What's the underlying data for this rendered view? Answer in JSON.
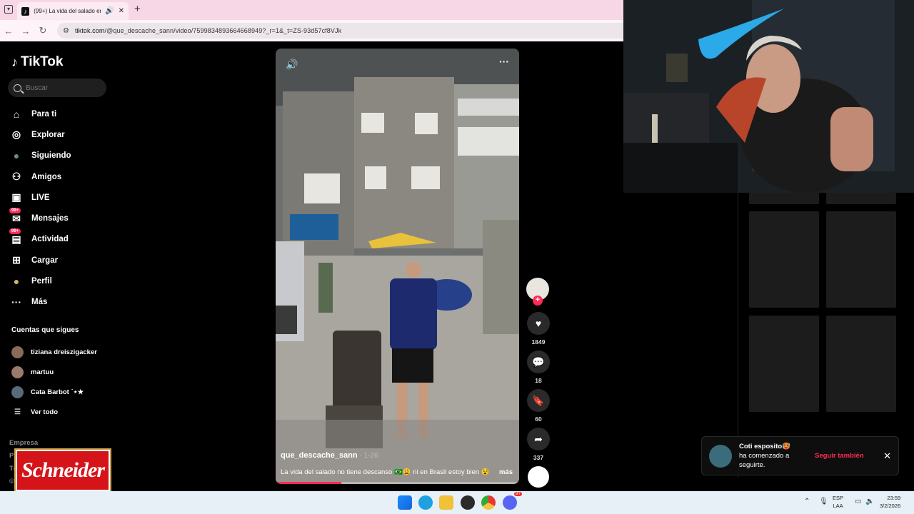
{
  "browser": {
    "tab_title": "(99+) La vida del salado en",
    "tab_sound_icon": "speaker-icon",
    "tab_close": "✕",
    "new_tab": "+",
    "url_domain": "tiktok.com",
    "url_path": "/@que_descache_sann/video/7599834893664668949?_r=1&_t=ZS-93d57cf8VJk"
  },
  "sidebar": {
    "brand": "TikTok",
    "search_placeholder": "Buscar",
    "nav": [
      {
        "label": "Para ti",
        "icon": "home-icon"
      },
      {
        "label": "Explorar",
        "icon": "compass-icon"
      },
      {
        "label": "Siguiendo",
        "icon": "following-avatar-icon"
      },
      {
        "label": "Amigos",
        "icon": "friends-icon"
      },
      {
        "label": "LIVE",
        "icon": "live-icon"
      },
      {
        "label": "Mensajes",
        "icon": "messages-icon",
        "badge": "99+"
      },
      {
        "label": "Actividad",
        "icon": "activity-icon",
        "badge": "99+"
      },
      {
        "label": "Cargar",
        "icon": "upload-icon"
      },
      {
        "label": "Perfil",
        "icon": "profile-avatar-icon"
      },
      {
        "label": "Más",
        "icon": "more-dots-icon"
      }
    ],
    "following_header": "Cuentas que sigues",
    "following": [
      {
        "name": "tiziana dreiszigacker"
      },
      {
        "name": "martuu"
      },
      {
        "name": "Cata Barbot ˙⋆★"
      }
    ],
    "see_all": "Ver todo",
    "footer": [
      "Empresa",
      "Programa",
      "Té",
      "©"
    ],
    "overlay_logo": "Schneider"
  },
  "video": {
    "author": "que_descache_sann",
    "date": " · 1-26",
    "caption": "La vida del salado no tiene descanso 🇧🇷😩 ni en Brasil estoy bien 😵",
    "more": "más",
    "progress": 0.27,
    "volume_icon": "volume-icon",
    "menu": "···"
  },
  "actions": {
    "likes": "1849",
    "comments": "18",
    "saves": "60",
    "shares": "337"
  },
  "notification": {
    "name": "Coti esposito🥵",
    "message": "ha comenzado a seguirte.",
    "action": "Seguir también",
    "close": "✕"
  },
  "taskbar": {
    "lang": "ESP",
    "layout": "LAA",
    "time": "23:59",
    "date": "3/2/2026",
    "chat_badge": "9+"
  },
  "colors": {
    "accent": "#fe2c55",
    "tab_bar": "#f7d7e6",
    "taskbar": "#e6f0f6"
  }
}
